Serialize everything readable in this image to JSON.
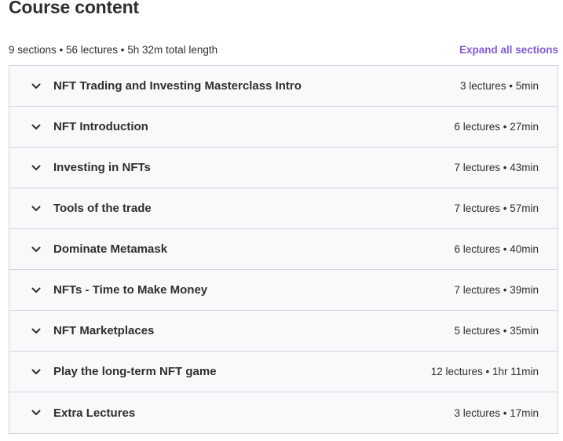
{
  "header": {
    "title": "Course content"
  },
  "summary": {
    "text": "9 sections • 56 lectures • 5h 32m total length",
    "expand_label": "Expand all sections"
  },
  "icons": {
    "section_toggle": "chevron-down-icon"
  },
  "colors": {
    "accent": "#5624d0",
    "section_bg": "#f7f9fa",
    "border": "#d1d7dc",
    "text": "#2d2f31"
  },
  "sections": [
    {
      "title": "NFT Trading and Investing Masterclass Intro",
      "meta": "3 lectures • 5min"
    },
    {
      "title": "NFT Introduction",
      "meta": "6 lectures • 27min"
    },
    {
      "title": "Investing in NFTs",
      "meta": "7 lectures • 43min"
    },
    {
      "title": "Tools of the trade",
      "meta": "7 lectures • 57min"
    },
    {
      "title": "Dominate Metamask",
      "meta": "6 lectures • 40min"
    },
    {
      "title": "NFTs - Time to Make Money",
      "meta": "7 lectures • 39min"
    },
    {
      "title": "NFT Marketplaces",
      "meta": "5 lectures • 35min"
    },
    {
      "title": "Play the long-term NFT game",
      "meta": "12 lectures • 1hr 11min"
    },
    {
      "title": "Extra Lectures",
      "meta": "3 lectures • 17min"
    }
  ]
}
